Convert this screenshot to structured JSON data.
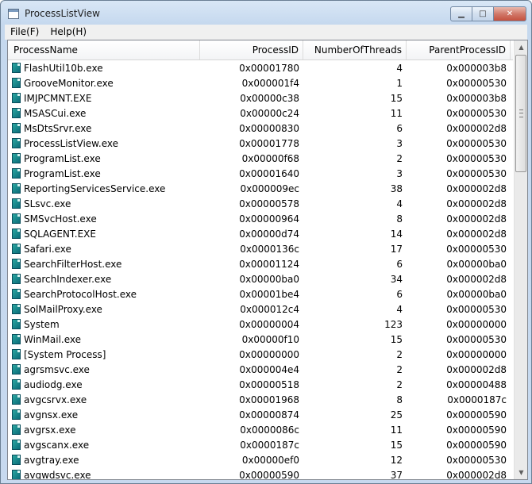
{
  "window": {
    "title": "ProcessListView",
    "minimize_glyph": "▁",
    "maximize_glyph": "□",
    "close_glyph": "✕"
  },
  "menu": [
    {
      "label": "File(F)"
    },
    {
      "label": "Help(H)"
    }
  ],
  "table": {
    "columns": [
      "ProcessName",
      "ProcessID",
      "NumberOfThreads",
      "ParentProcessID"
    ],
    "rows": [
      {
        "name": "FlashUtil10b.exe",
        "pid": "0x00001780",
        "threads": "4",
        "ppid": "0x000003b8"
      },
      {
        "name": "GrooveMonitor.exe",
        "pid": "0x000001f4",
        "threads": "1",
        "ppid": "0x00000530"
      },
      {
        "name": "IMJPCMNT.EXE",
        "pid": "0x00000c38",
        "threads": "15",
        "ppid": "0x000003b8"
      },
      {
        "name": "MSASCui.exe",
        "pid": "0x00000c24",
        "threads": "11",
        "ppid": "0x00000530"
      },
      {
        "name": "MsDtsSrvr.exe",
        "pid": "0x00000830",
        "threads": "6",
        "ppid": "0x000002d8"
      },
      {
        "name": "ProcessListView.exe",
        "pid": "0x00001778",
        "threads": "3",
        "ppid": "0x00000530"
      },
      {
        "name": "ProgramList.exe",
        "pid": "0x00000f68",
        "threads": "2",
        "ppid": "0x00000530"
      },
      {
        "name": "ProgramList.exe",
        "pid": "0x00001640",
        "threads": "3",
        "ppid": "0x00000530"
      },
      {
        "name": "ReportingServicesService.exe",
        "pid": "0x000009ec",
        "threads": "38",
        "ppid": "0x000002d8"
      },
      {
        "name": "SLsvc.exe",
        "pid": "0x00000578",
        "threads": "4",
        "ppid": "0x000002d8"
      },
      {
        "name": "SMSvcHost.exe",
        "pid": "0x00000964",
        "threads": "8",
        "ppid": "0x000002d8"
      },
      {
        "name": "SQLAGENT.EXE",
        "pid": "0x00000d74",
        "threads": "14",
        "ppid": "0x000002d8"
      },
      {
        "name": "Safari.exe",
        "pid": "0x0000136c",
        "threads": "17",
        "ppid": "0x00000530"
      },
      {
        "name": "SearchFilterHost.exe",
        "pid": "0x00001124",
        "threads": "6",
        "ppid": "0x00000ba0"
      },
      {
        "name": "SearchIndexer.exe",
        "pid": "0x00000ba0",
        "threads": "34",
        "ppid": "0x000002d8"
      },
      {
        "name": "SearchProtocolHost.exe",
        "pid": "0x00001be4",
        "threads": "6",
        "ppid": "0x00000ba0"
      },
      {
        "name": "SolMailProxy.exe",
        "pid": "0x000012c4",
        "threads": "4",
        "ppid": "0x00000530"
      },
      {
        "name": "System",
        "pid": "0x00000004",
        "threads": "123",
        "ppid": "0x00000000"
      },
      {
        "name": "WinMail.exe",
        "pid": "0x00000f10",
        "threads": "15",
        "ppid": "0x00000530"
      },
      {
        "name": "[System Process]",
        "pid": "0x00000000",
        "threads": "2",
        "ppid": "0x00000000"
      },
      {
        "name": "agrsmsvc.exe",
        "pid": "0x000004e4",
        "threads": "2",
        "ppid": "0x000002d8"
      },
      {
        "name": "audiodg.exe",
        "pid": "0x00000518",
        "threads": "2",
        "ppid": "0x00000488"
      },
      {
        "name": "avgcsrvx.exe",
        "pid": "0x00001968",
        "threads": "8",
        "ppid": "0x0000187c"
      },
      {
        "name": "avgnsx.exe",
        "pid": "0x00000874",
        "threads": "25",
        "ppid": "0x00000590"
      },
      {
        "name": "avgrsx.exe",
        "pid": "0x0000086c",
        "threads": "11",
        "ppid": "0x00000590"
      },
      {
        "name": "avgscanx.exe",
        "pid": "0x0000187c",
        "threads": "15",
        "ppid": "0x00000590"
      },
      {
        "name": "avgtray.exe",
        "pid": "0x00000ef0",
        "threads": "12",
        "ppid": "0x00000530"
      },
      {
        "name": "avgwdsvc.exe",
        "pid": "0x00000590",
        "threads": "37",
        "ppid": "0x000002d8"
      }
    ]
  },
  "scrollbar": {
    "up_glyph": "▲",
    "down_glyph": "▼"
  },
  "icons": {
    "app": "window-app-icon",
    "process": "process-exe-icon"
  }
}
